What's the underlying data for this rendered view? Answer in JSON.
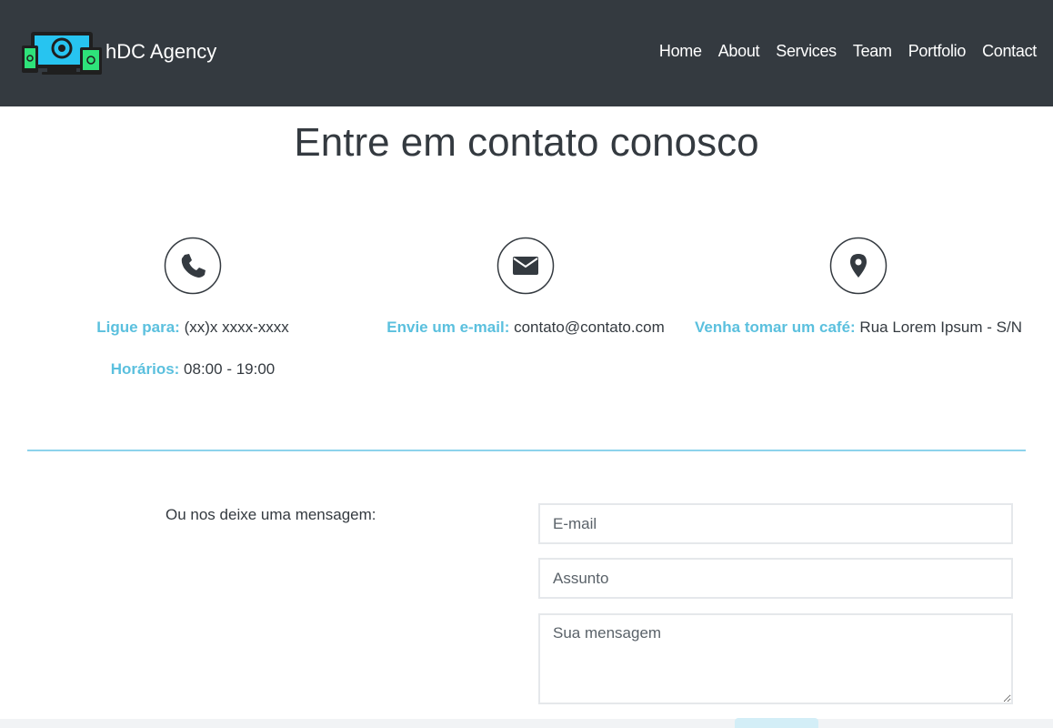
{
  "navbar": {
    "brand_name": "hDC Agency",
    "links": [
      {
        "label": "Home"
      },
      {
        "label": "About"
      },
      {
        "label": "Services"
      },
      {
        "label": "Team"
      },
      {
        "label": "Portfolio"
      },
      {
        "label": "Contact"
      }
    ]
  },
  "page_title": "Entre em contato conosco",
  "contact_info": {
    "phone": {
      "icon": "phone-icon",
      "label": "Ligue para:",
      "value": " (xx)x xxxx-xxxx"
    },
    "hours": {
      "label": "Horários:",
      "value": " 08:00 - 19:00"
    },
    "email": {
      "icon": "envelope-icon",
      "label": "Envie um e-mail:",
      "value": " contato@contato.com"
    },
    "address": {
      "icon": "map-marker-icon",
      "label": "Venha tomar um café:",
      "value": " Rua Lorem Ipsum - S/N"
    }
  },
  "form": {
    "prompt": "Ou nos deixe uma mensagem:",
    "email_placeholder": "E-mail",
    "subject_placeholder": "Assunto",
    "message_placeholder": "Sua mensagem"
  },
  "colors": {
    "navbar_bg": "#343a40",
    "accent": "#5bc0de",
    "text": "#343a40",
    "divider": "#8dd3ec"
  }
}
